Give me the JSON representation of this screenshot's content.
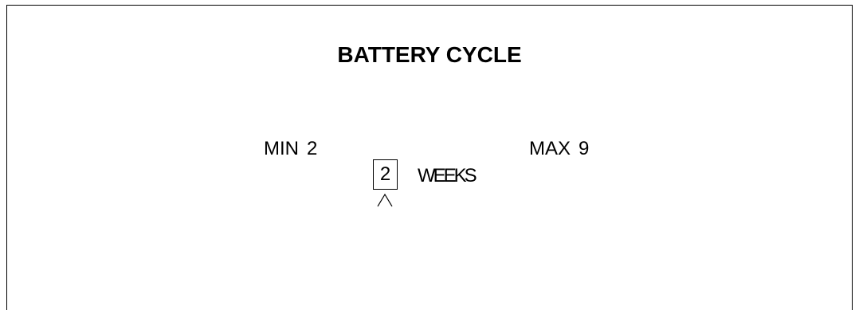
{
  "screen": {
    "title": "BATTERY CYCLE",
    "min": {
      "label": "MIN",
      "value": "2"
    },
    "max": {
      "label": "MAX",
      "value": "9"
    },
    "setting": {
      "value": "2",
      "unit": "WEEKS"
    },
    "cursor_icon": "caret-up-icon"
  }
}
